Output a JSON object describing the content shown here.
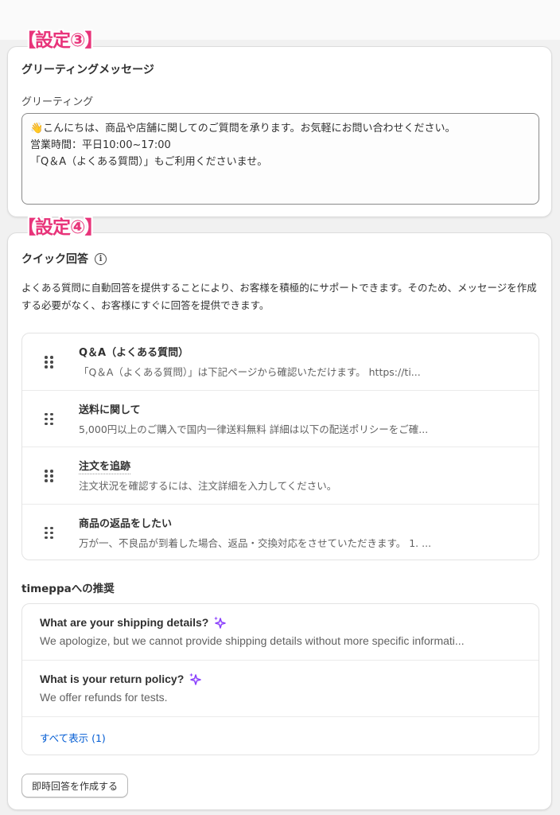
{
  "annotations": {
    "setting3": "【設定③】",
    "setting4": "【設定④】",
    "color": "#e8347a"
  },
  "greeting_section": {
    "title": "グリーティングメッセージ",
    "field_label": "グリーティング",
    "lines": [
      "👋こんにちは、商品や店舗に関してのご質問を承ります。お気軽にお問い合わせください。",
      "営業時間：平日10:00~17:00",
      "「Q＆A（よくある質問）」もご利用くださいませ。"
    ]
  },
  "quick_reply_section": {
    "title": "クイック回答",
    "info_icon": "info-icon",
    "description": "よくある質問に自動回答を提供することにより、お客様を積極的にサポートできます。そのため、メッセージを作成する必要がなく、お客様にすぐに回答を提供できます。",
    "items": [
      {
        "title": "Q＆A（よくある質問）",
        "preview": "「Q＆A（よくある質問）」は下記ページから確認いただけます。 https://ti..."
      },
      {
        "title": "送料に関して",
        "preview": "5,000円以上のご購入で国内一律送料無料 詳細は以下の配送ポリシーをご確..."
      },
      {
        "title": "注文を追跡",
        "preview": "注文状況を確認するには、注文詳細を入力してください。"
      },
      {
        "title": "商品の返品をしたい",
        "preview": "万が一、不良品が到着した場合、返品・交換対応をさせていただきます。 1. ..."
      }
    ]
  },
  "recommendations": {
    "heading": "timeppaへの推奨",
    "items": [
      {
        "title": "What are your shipping details?",
        "preview": "We apologize, but we cannot provide shipping details without more specific informati..."
      },
      {
        "title": "What is your return policy?",
        "preview": "We offer refunds for tests."
      }
    ],
    "show_all": "すべて表示 (1)",
    "sparkle_color": "#8a3ffc"
  },
  "create_button_label": "即時回答を作成する"
}
